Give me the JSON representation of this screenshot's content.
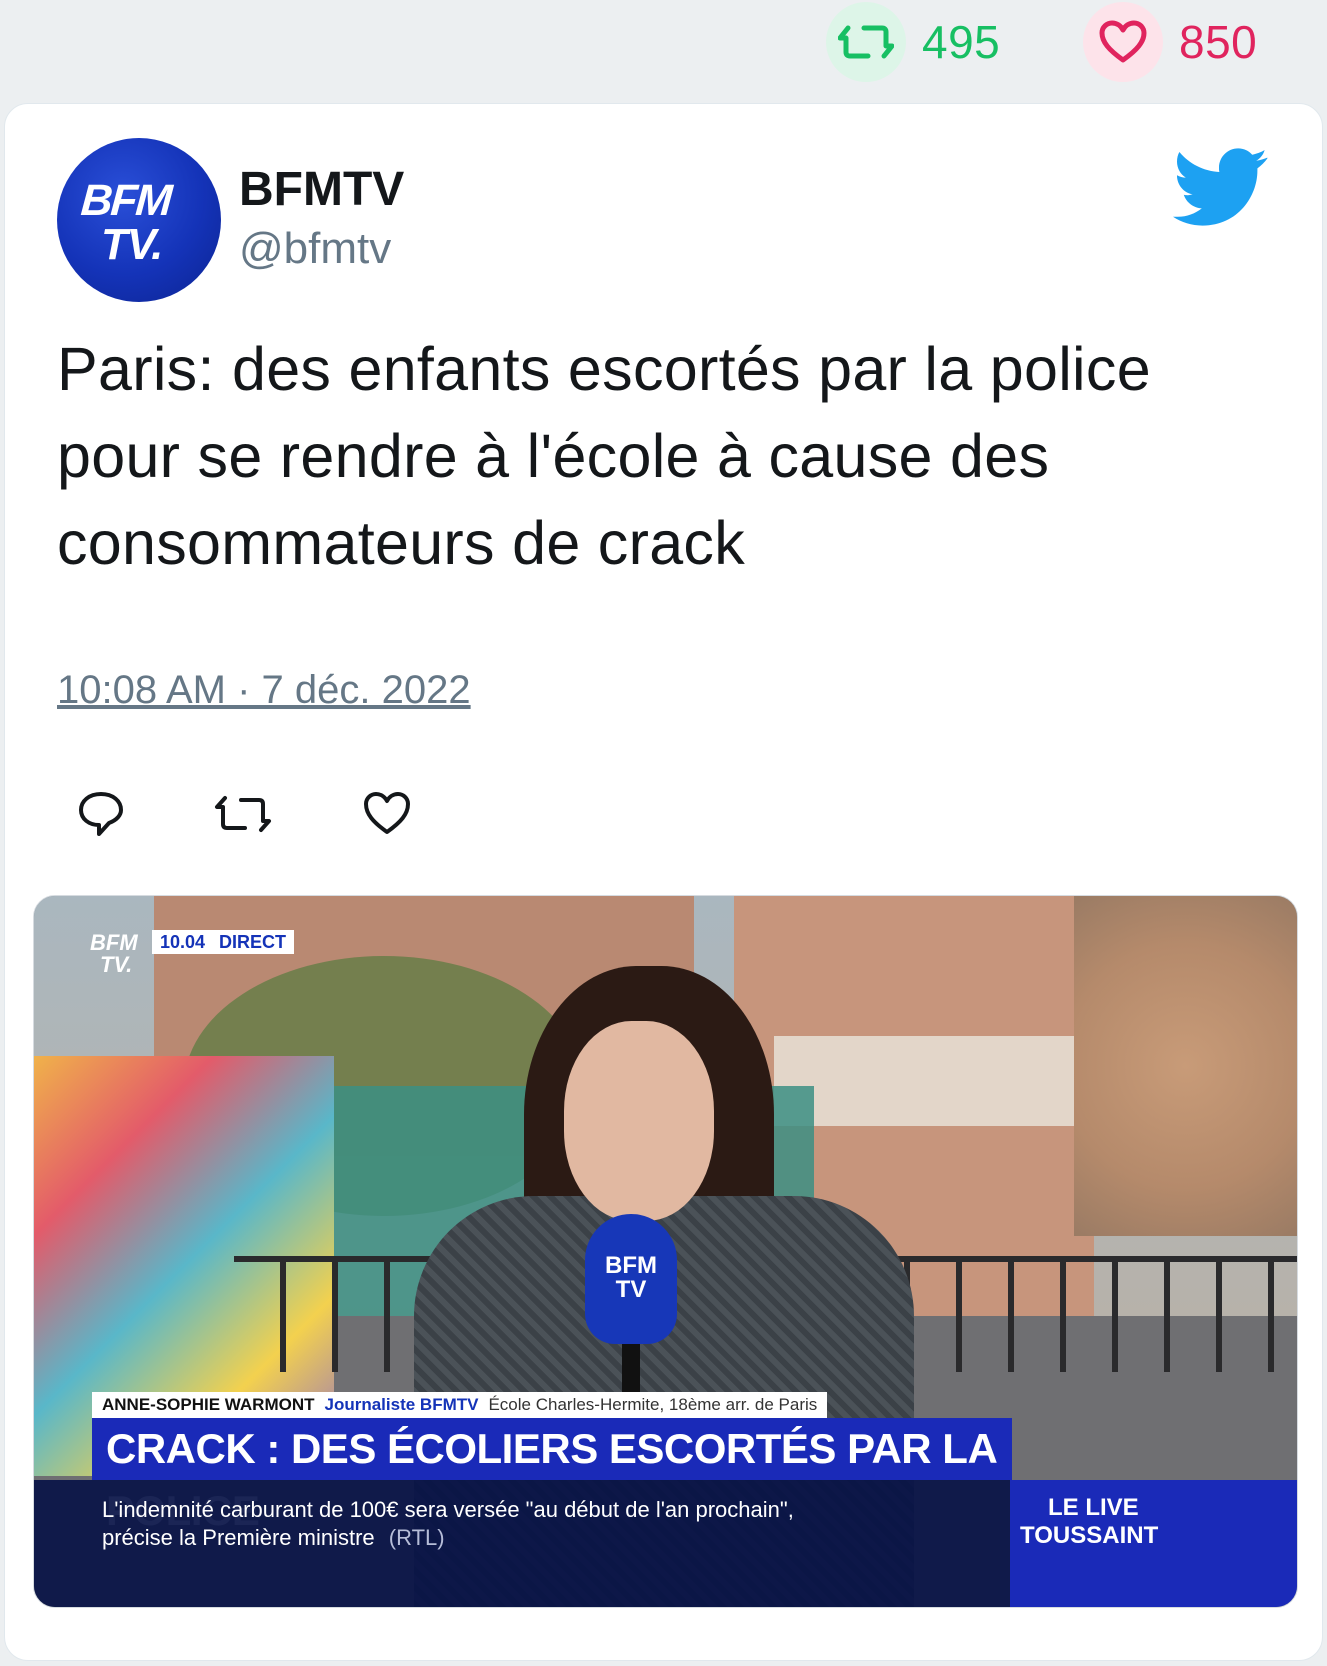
{
  "stats": {
    "retweets": "495",
    "likes": "850",
    "retweet_color": "#17bf63",
    "like_color": "#e0245e"
  },
  "tweet": {
    "author_name": "BFMTV",
    "author_handle": "@bfmtv",
    "avatar_text_line1": "BFM",
    "avatar_text_line2": "TV.",
    "text": "Paris: des enfants escortés par la police pour se rendre à l'école à cause des consommateurs de crack",
    "timestamp": "10:08 AM · 7 déc. 2022",
    "icons": [
      "reply-icon",
      "retweet-icon",
      "like-icon",
      "twitter-bird-icon"
    ],
    "accent_color": "#1da1f2"
  },
  "media": {
    "channel_logo_line1": "BFM",
    "channel_logo_line2": "TV.",
    "clock": "10.04",
    "live_badge": "DIRECT",
    "reporter_name": "ANNE-SOPHIE WARMONT",
    "reporter_role": "Journaliste BFMTV",
    "location": "École Charles-Hermite, 18ème arr. de Paris",
    "headline": "CRACK : DES ÉCOLIERS ESCORTÉS PAR LA POLICE",
    "ticker_line1": "L'indemnité carburant de 100€ sera versée \"au début de l'an prochain\",",
    "ticker_line2": "précise la Première ministre",
    "ticker_source": "(RTL)",
    "show_line1": "LE LIVE",
    "show_line2": "TOUSSAINT",
    "mic_line1": "BFM",
    "mic_line2": "TV"
  }
}
